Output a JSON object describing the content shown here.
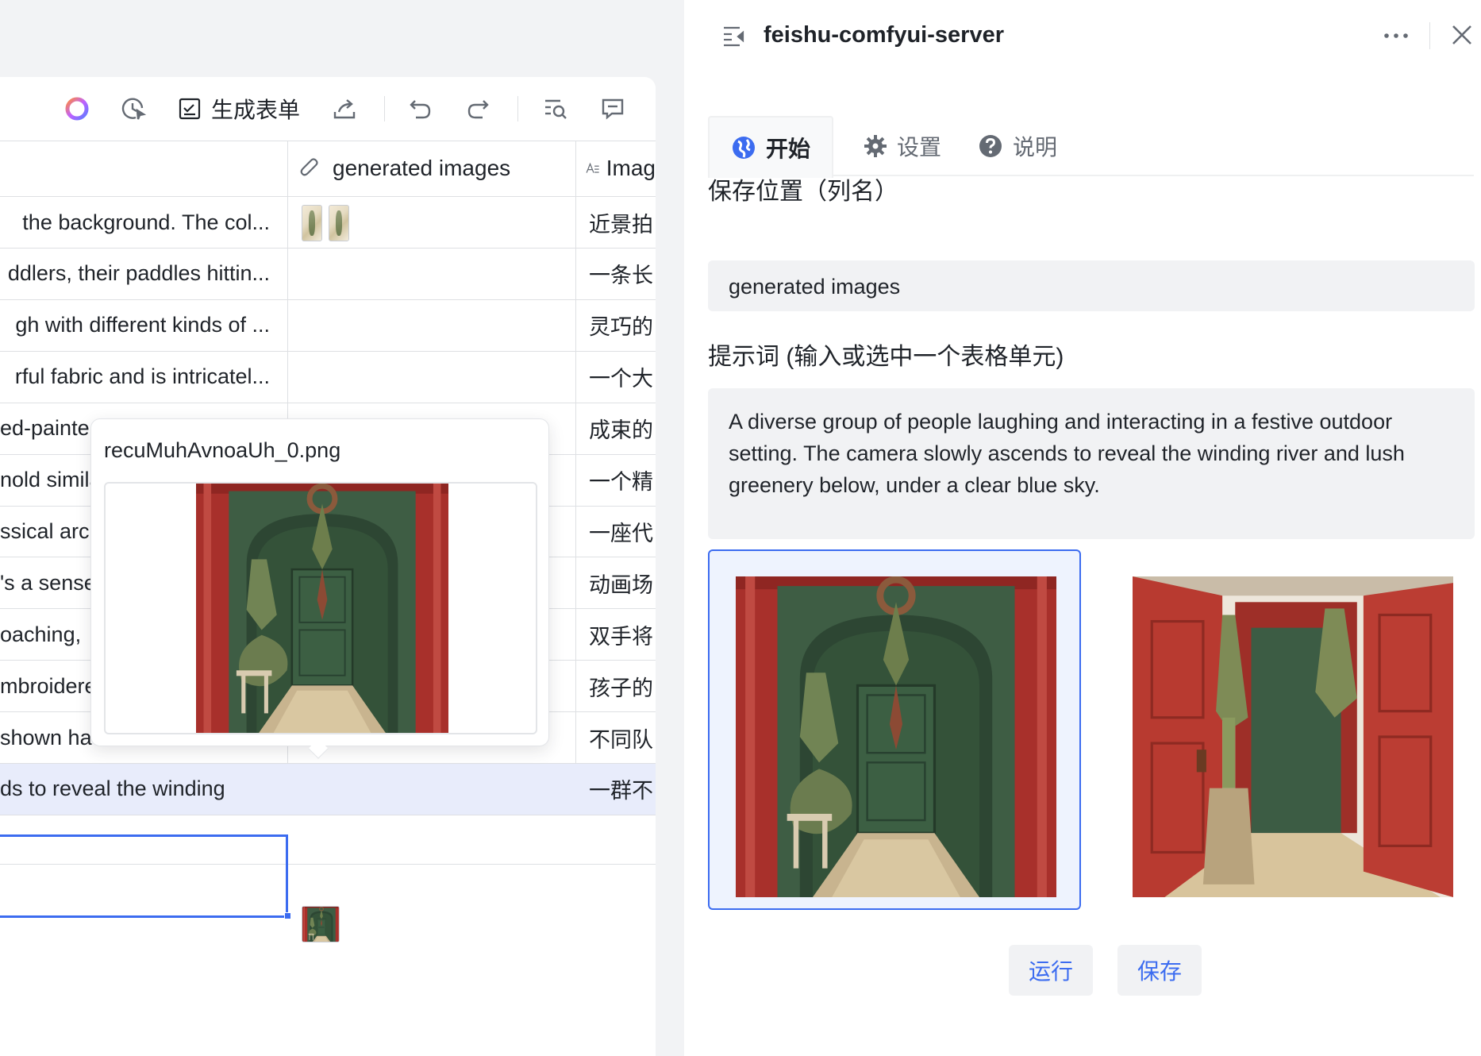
{
  "toolbar": {
    "form_label": "生成表单"
  },
  "table": {
    "columns": [
      {
        "label": "",
        "icon": "text-icon"
      },
      {
        "label": "generated images",
        "icon": "attachment-icon"
      },
      {
        "label": "Imag",
        "icon": "text-field-icon"
      }
    ],
    "rows": [
      {
        "prompt": "the background. The col...",
        "zh": "近景拍"
      },
      {
        "prompt": "ddlers, their paddles hittin...",
        "zh": "一条长"
      },
      {
        "prompt": "gh with different kinds of ...",
        "zh": "灵巧的"
      },
      {
        "prompt": "rful fabric and is intricatel...",
        "zh": "一个大"
      },
      {
        "prompt": "ed-painte",
        "zh": "成束的"
      },
      {
        "prompt": "nold simila",
        "zh": "一个精"
      },
      {
        "prompt": "ssical arc",
        "zh": "一座代"
      },
      {
        "prompt": "'s a sense",
        "zh": "动画场"
      },
      {
        "prompt": "oaching,",
        "zh": "双手将"
      },
      {
        "prompt": "mbroidere",
        "zh": "孩子的"
      },
      {
        "prompt": "shown ha",
        "zh": "不同队"
      },
      {
        "prompt": "ds to reveal the winding",
        "zh": "一群不"
      }
    ]
  },
  "popup": {
    "filename": "recuMuhAvnoaUh_0.png"
  },
  "panel": {
    "title": "feishu-comfyui-server",
    "tabs": [
      {
        "label": "开始",
        "icon": "globe-icon"
      },
      {
        "label": "设置",
        "icon": "gear-icon"
      },
      {
        "label": "说明",
        "icon": "question-icon"
      }
    ],
    "save_location_label": "保存位置（列名）",
    "save_location_value": "generated images",
    "prompt_label": "提示词 (输入或选中一个表格单元)",
    "prompt_value": "A diverse group of people laughing and interacting in a festive outdoor setting. The camera slowly ascends to reveal the winding river and lush greenery below, under a clear blue sky.",
    "run_label": "运行",
    "save_label": "保存"
  },
  "colors": {
    "accent": "#3c6cf0",
    "door_red": "#b23a32",
    "door_green": "#3f5e45"
  }
}
